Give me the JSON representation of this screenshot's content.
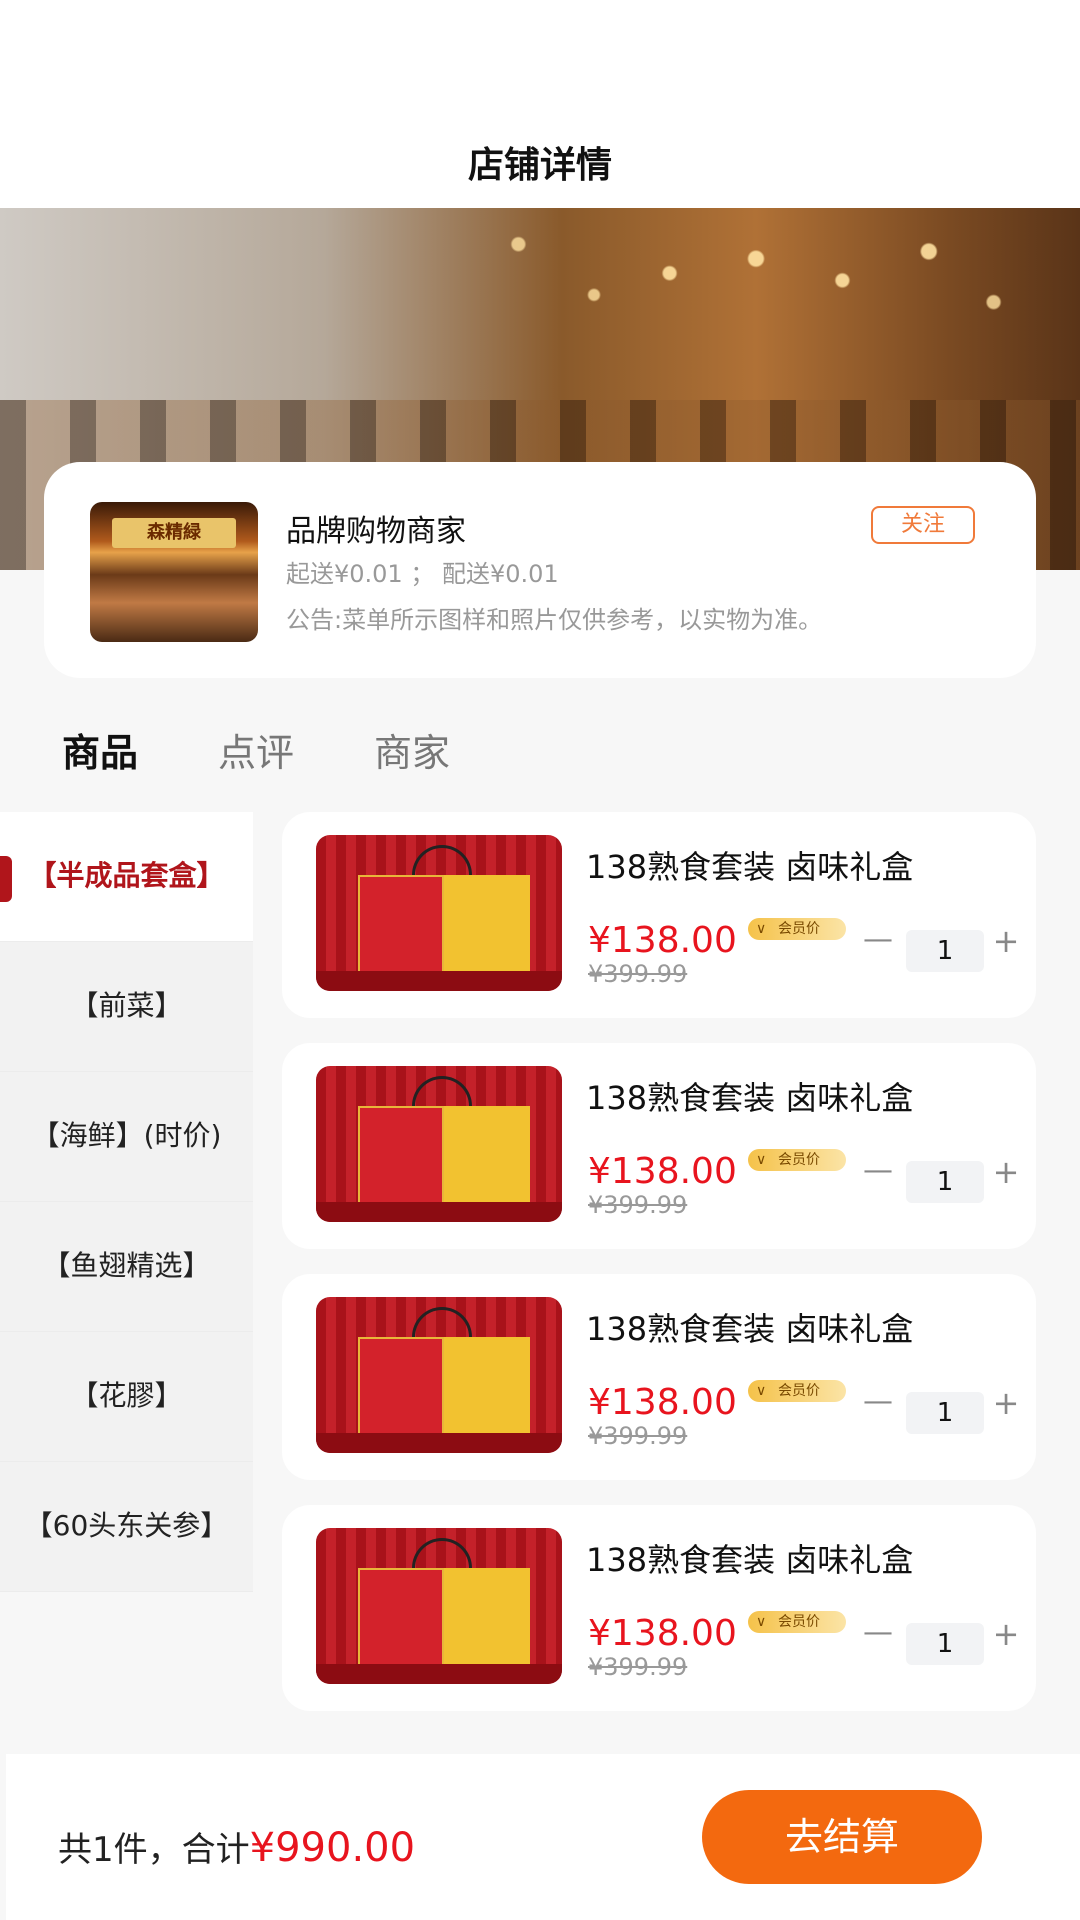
{
  "header": {
    "title": "店铺详情"
  },
  "store": {
    "logo_sign": "森精緑",
    "name": "品牌购物商家",
    "follow_label": "关注",
    "delivery": "起送¥0.01 ； 配送¥0.01",
    "notice": "公告:菜单所示图样和照片仅供参考，以实物为准。"
  },
  "tabs": [
    {
      "label": "商品",
      "active": true
    },
    {
      "label": "点评",
      "active": false
    },
    {
      "label": "商家",
      "active": false
    }
  ],
  "categories": [
    {
      "label": "【半成品套盒】",
      "active": true
    },
    {
      "label": "【前菜】",
      "active": false
    },
    {
      "label": "【海鲜】(时价)",
      "active": false
    },
    {
      "label": "【鱼翅精选】",
      "active": false
    },
    {
      "label": "【花膠】",
      "active": false
    },
    {
      "label": "【60头东关参】",
      "active": false
    }
  ],
  "products": [
    {
      "name": "138熟食套装 卤味礼盒",
      "price": "¥138.00",
      "member_tag": "会员价",
      "original_price": "¥399.99",
      "qty": "1",
      "minus": "—",
      "plus": "+"
    },
    {
      "name": "138熟食套装 卤味礼盒",
      "price": "¥138.00",
      "member_tag": "会员价",
      "original_price": "¥399.99",
      "qty": "1",
      "minus": "—",
      "plus": "+"
    },
    {
      "name": "138熟食套装 卤味礼盒",
      "price": "¥138.00",
      "member_tag": "会员价",
      "original_price": "¥399.99",
      "qty": "1",
      "minus": "—",
      "plus": "+"
    },
    {
      "name": "138熟食套装 卤味礼盒",
      "price": "¥138.00",
      "member_tag": "会员价",
      "original_price": "¥399.99",
      "qty": "1",
      "minus": "—",
      "plus": "+"
    }
  ],
  "cart": {
    "summary_prefix": "共1件，合计",
    "total": "¥990.00",
    "checkout_label": "去结算"
  },
  "colors": {
    "accent": "#f3690f",
    "price": "#e8141e",
    "category_active": "#b0151b"
  }
}
